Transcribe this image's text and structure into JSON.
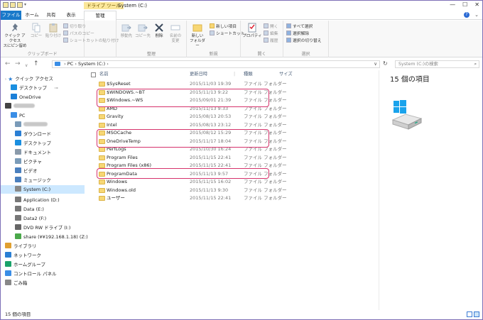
{
  "titlebar": {
    "context_tab": "ドライブ ツール",
    "title": "System (C:)",
    "buttons": [
      "—",
      "☐",
      "✕"
    ]
  },
  "tabs": [
    "ファイル",
    "ホーム",
    "共有",
    "表示",
    "管理"
  ],
  "ribbon": {
    "clipboard": {
      "pin": "クイック アクセス\nスにピン留め",
      "copy": "コピー",
      "paste": "貼り付け",
      "cut": "切り取り",
      "copy_path": "パスのコピー",
      "paste_shortcut": "ショートカットの貼り付け",
      "label": "クリップボード"
    },
    "organize": {
      "move_to": "移動先",
      "copy_to": "コピー先",
      "delete": "削除",
      "rename": "名前の\n変更",
      "label": "整理"
    },
    "new": {
      "new_folder": "新しい\nフォルダー",
      "new_item": "新しい項目",
      "shortcut": "ショートカット",
      "label": "新規"
    },
    "open": {
      "properties": "プロパティ",
      "open": "開く",
      "edit": "編集",
      "history": "履歴",
      "label": "開く"
    },
    "select": {
      "select_all": "すべて選択",
      "select_none": "選択解除",
      "invert": "選択の切り替え",
      "label": "選択"
    }
  },
  "nav": {
    "crumb_root": "PC",
    "crumb_current": "System (C:)",
    "search_placeholder": "System (C:)の検索"
  },
  "sidebar": {
    "quick_access": "クイック アクセス",
    "items": [
      {
        "label": "デスクトップ",
        "pin": true
      },
      {
        "label": "OneDrive"
      },
      {
        "label": "PC"
      },
      {
        "label": "ダウンロード"
      },
      {
        "label": "デスクトップ"
      },
      {
        "label": "ドキュメント"
      },
      {
        "label": "ピクチャ"
      },
      {
        "label": "ビデオ"
      },
      {
        "label": "ミュージック"
      },
      {
        "label": "System (C:)"
      },
      {
        "label": "Application (D:)"
      },
      {
        "label": "Data (E:)"
      },
      {
        "label": "Data2 (F:)"
      },
      {
        "label": "DVD RW ドライブ (I:)"
      },
      {
        "label": "share (¥¥192.168.1.18) (Z:)"
      },
      {
        "label": "ライブラリ"
      },
      {
        "label": "ネットワーク"
      },
      {
        "label": "ホームグループ"
      },
      {
        "label": "コントロール パネル"
      },
      {
        "label": "ごみ箱"
      }
    ]
  },
  "columns": [
    "名前",
    "更新日時",
    "種類",
    "サイズ"
  ],
  "files": [
    {
      "name": "$SysReset",
      "date": "2015/11/03 19:39",
      "type": "ファイル フォルダー"
    },
    {
      "name": "$WINDOWS.~BT",
      "date": "2015/11/13 9:22",
      "type": "ファイル フォルダー"
    },
    {
      "name": "$Windows.~WS",
      "date": "2015/09/01 21:39",
      "type": "ファイル フォルダー"
    },
    {
      "name": "AMD",
      "date": "2015/11/13 9:33",
      "type": "ファイル フォルダー"
    },
    {
      "name": "Gravity",
      "date": "2015/08/13 20:53",
      "type": "ファイル フォルダー"
    },
    {
      "name": "Intel",
      "date": "2015/08/13 23:12",
      "type": "ファイル フォルダー"
    },
    {
      "name": "MSOCache",
      "date": "2015/08/12 15:29",
      "type": "ファイル フォルダー"
    },
    {
      "name": "OneDriveTemp",
      "date": "2015/11/17 18:04",
      "type": "ファイル フォルダー"
    },
    {
      "name": "PerfLogs",
      "date": "2015/10/30 16:24",
      "type": "ファイル フォルダー"
    },
    {
      "name": "Program Files",
      "date": "2015/11/15 22:41",
      "type": "ファイル フォルダー"
    },
    {
      "name": "Program Files (x86)",
      "date": "2015/11/15 22:41",
      "type": "ファイル フォルダー"
    },
    {
      "name": "ProgramData",
      "date": "2015/11/13 9:57",
      "type": "ファイル フォルダー"
    },
    {
      "name": "Windows",
      "date": "2015/11/15 16:02",
      "type": "ファイル フォルダー"
    },
    {
      "name": "Windows.old",
      "date": "2015/11/13 9:30",
      "type": "ファイル フォルダー"
    },
    {
      "name": "ユーザー",
      "date": "2015/11/15 22:41",
      "type": "ファイル フォルダー"
    }
  ],
  "preview": {
    "count": "15 個の項目"
  },
  "status": {
    "count": "15 個の項目"
  },
  "colors": {
    "accent": "#1979ca",
    "highlight": "#d6336c",
    "context_tab": "#fbe79a"
  }
}
